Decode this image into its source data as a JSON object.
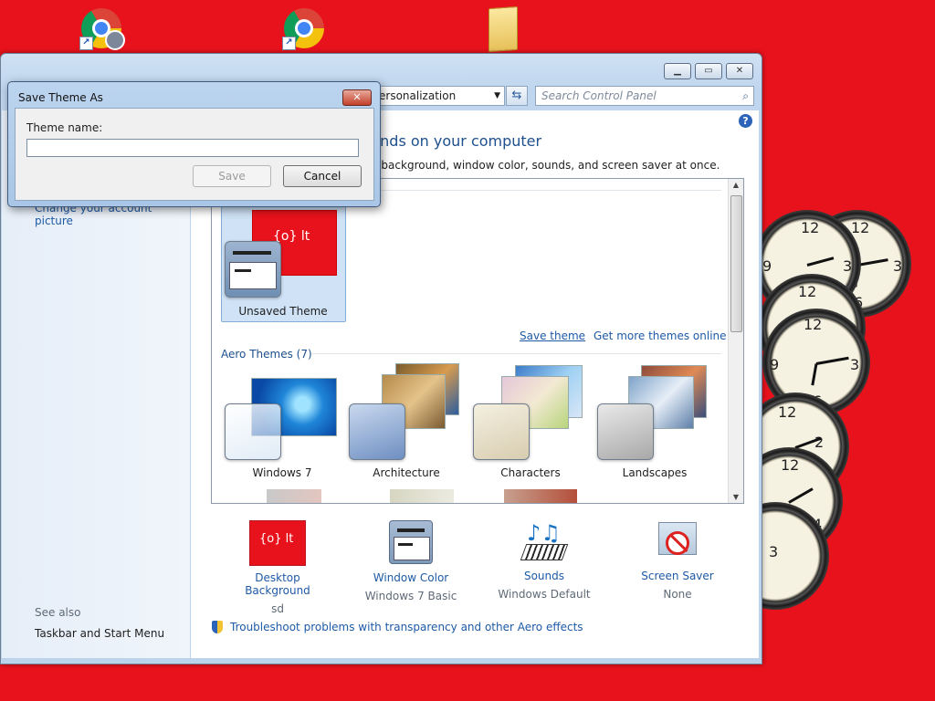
{
  "desktop": {
    "icons": [
      {
        "name": "chrome-profile-shortcut"
      },
      {
        "name": "chrome-shortcut"
      },
      {
        "name": "folder"
      }
    ]
  },
  "window": {
    "address_text": "ersonalization",
    "search_placeholder": "Search Control Panel",
    "help_label": "?",
    "heading": "unds on your computer",
    "subheading": "p background, window color, sounds, and screen saver at once.",
    "left_pane": {
      "account_picture_link": "Change your account picture",
      "see_also_label": "See also",
      "taskbar_link": "Taskbar and Start Menu"
    },
    "my_themes": {
      "unsaved_theme_label": "Unsaved Theme",
      "save_theme_link": "Save theme",
      "get_more_link": "Get more themes online"
    },
    "aero_themes": {
      "heading": "Aero Themes (7)",
      "items": [
        {
          "label": "Windows 7"
        },
        {
          "label": "Architecture"
        },
        {
          "label": "Characters"
        },
        {
          "label": "Landscapes"
        }
      ]
    },
    "bottom_bar": [
      {
        "title": "Desktop Background",
        "value": "sd"
      },
      {
        "title": "Window Color",
        "value": "Windows 7 Basic"
      },
      {
        "title": "Sounds",
        "value": "Windows Default"
      },
      {
        "title": "Screen Saver",
        "value": "None"
      }
    ],
    "troubleshoot_link": "Troubleshoot problems with transparency and other Aero effects",
    "caption_buttons": {
      "minimize": "▁",
      "maximize": "▭",
      "close": "✕"
    }
  },
  "dialog": {
    "title": "Save Theme As",
    "theme_name_label": "Theme name:",
    "theme_name_value": "",
    "save_button": "Save",
    "cancel_button": "Cancel",
    "close_button": "✕"
  },
  "colors": {
    "desktop_red": "#e8121c",
    "link_blue": "#1e5aa6",
    "selected_theme_bg": "#cfe2f6"
  }
}
